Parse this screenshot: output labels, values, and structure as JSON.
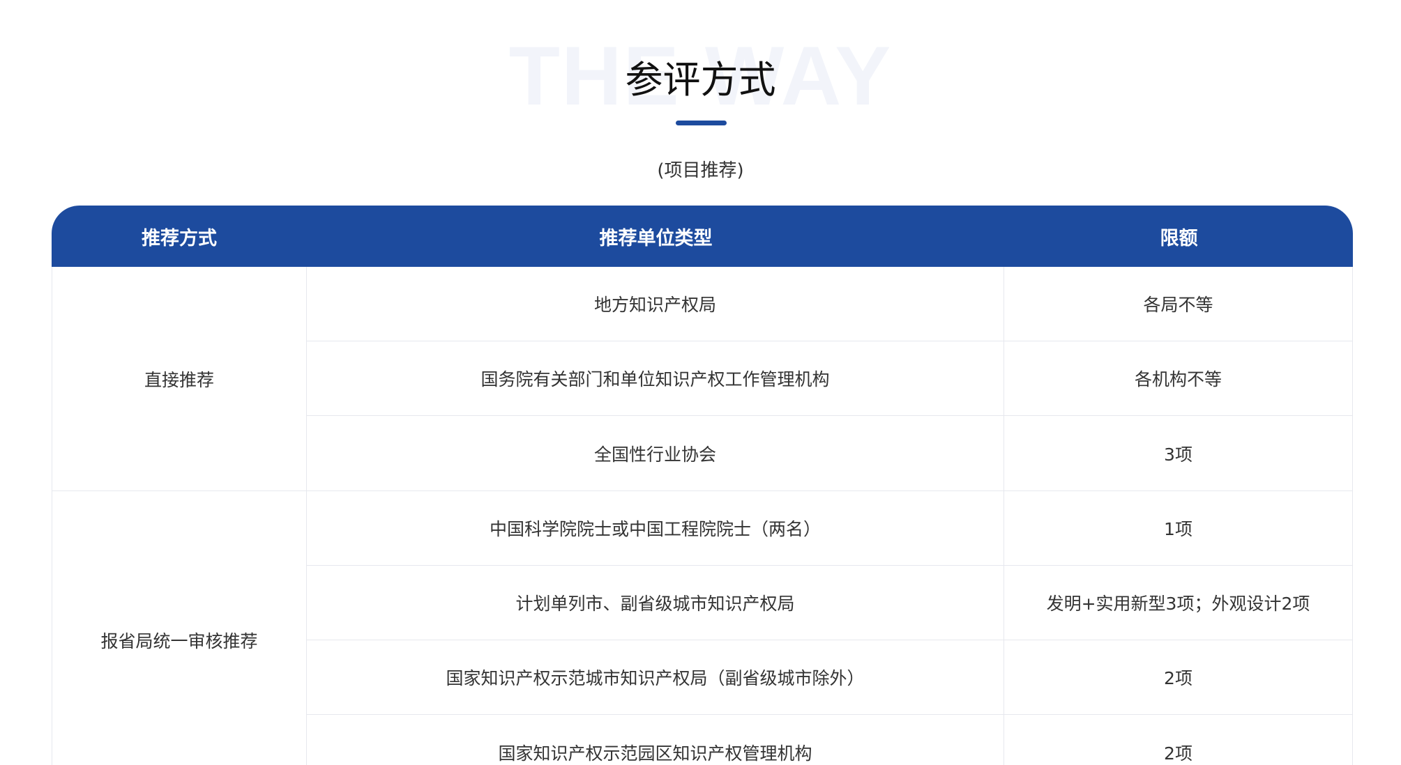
{
  "header": {
    "watermark": "THE WAY",
    "title": "参评方式",
    "subtitle": "(项目推荐)"
  },
  "table": {
    "columns": [
      "推荐方式",
      "推荐单位类型",
      "限额"
    ],
    "groups": [
      {
        "method": "直接推荐",
        "rows": [
          {
            "unit": "地方知识产权局",
            "quota": "各局不等"
          },
          {
            "unit": "国务院有关部门和单位知识产权工作管理机构",
            "quota": "各机构不等"
          },
          {
            "unit": "全国性行业协会",
            "quota": "3项"
          }
        ]
      },
      {
        "method": "报省局统一审核推荐",
        "rows": [
          {
            "unit": "中国科学院院士或中国工程院院士（两名）",
            "quota": "1项"
          },
          {
            "unit": "计划单列市、副省级城市知识产权局",
            "quota": "发明+实用新型3项；外观设计2项"
          },
          {
            "unit": "国家知识产权示范城市知识产权局（副省级城市除外）",
            "quota": "2项"
          },
          {
            "unit": "国家知识产权示范园区知识产权管理机构",
            "quota": "2项"
          }
        ]
      }
    ]
  },
  "colors": {
    "accent": "#1d4b9e",
    "watermark": "#f2f4fa",
    "border": "#e6e8ee",
    "text": "#333333"
  }
}
